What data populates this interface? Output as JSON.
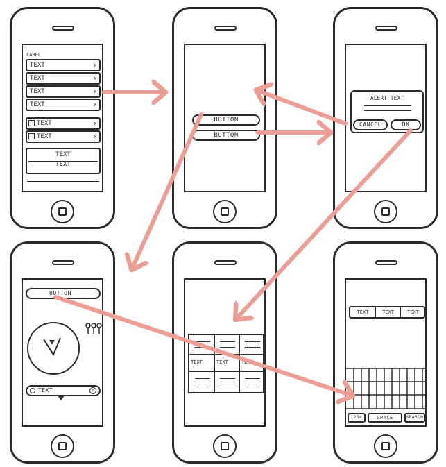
{
  "screens": {
    "list": {
      "label": "LABEL",
      "rows": [
        "TEXT",
        "TEXT",
        "TEXT",
        "TEXT"
      ],
      "check_rows": [
        "TEXT",
        "TEXT"
      ],
      "footer_lines": [
        "TEXT",
        "TEXT"
      ]
    },
    "buttons": {
      "button_1": "BUTTON",
      "button_2": "BUTTON"
    },
    "alert": {
      "title": "ALERT TEXT",
      "cancel": "CANCEL",
      "ok": "OK"
    },
    "clock": {
      "button": "BUTTON",
      "search_text": "TEXT"
    },
    "grid": {
      "cells": [
        "TEXT",
        "TEXT",
        "TEXT"
      ]
    },
    "keyboard": {
      "segments": [
        "TEXT",
        "TEXT",
        "TEXT"
      ],
      "key_numbers": "1234",
      "key_space": "SPACE",
      "key_search": "SEARCH"
    }
  },
  "colors": {
    "arrow": "#ec9e94",
    "ink": "#2b2b2b"
  }
}
